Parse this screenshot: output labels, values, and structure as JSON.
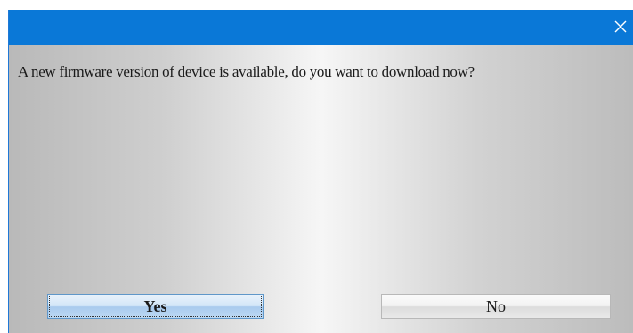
{
  "dialog": {
    "message": "A new firmware version of device is available, do you want to download now?",
    "close_icon": "close-x-icon",
    "buttons": {
      "yes_label": "Yes",
      "no_label": "No"
    },
    "colors": {
      "titlebar": "#0a78d7",
      "close_icon": "#ffffff",
      "default_button": "#bcd8f3"
    }
  }
}
